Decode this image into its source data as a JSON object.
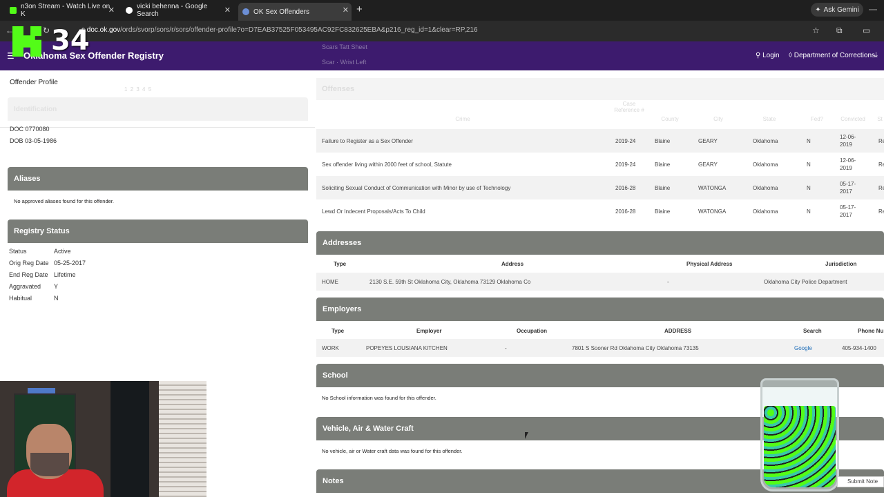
{
  "browser": {
    "tabs": [
      {
        "title": "n3on Stream - Watch Live on K",
        "icon": "kick-favicon"
      },
      {
        "title": "vicki behenna - Google Search",
        "icon": "google-favicon"
      },
      {
        "title": "OK Sex Offenders",
        "icon": "ok-favicon"
      }
    ],
    "new_tab": "+",
    "ask_gemini": "Ask Gemini",
    "url_domain": "s.doc.ok.gov",
    "url_path": "/ords/svorp/sors/r/sors/offender-profile?o=D7EAB37525F053495AC92FC832625EBA&p216_reg_id=1&clear=RP,216"
  },
  "overlay": {
    "stream_number": "34"
  },
  "header": {
    "site_title": "Oklahoma Sex Offender Registry",
    "ghost_line_1": "Scars Tatt Sheet",
    "ghost_line_2": "Scar · Wrist Left",
    "login": "Login",
    "department": "Department of Corrections"
  },
  "left": {
    "page_title": "Offender Profile",
    "pager": "1 2 3 4 5",
    "identification_heading": "Identification",
    "doc_line": "DOC 0770080",
    "dob_line": "DOB 03-05-1986",
    "aliases_heading": "Aliases",
    "aliases_text": "No approved aliases found for this offender.",
    "registry_heading": "Registry Status",
    "registry": [
      {
        "label": "Status",
        "value": "Active"
      },
      {
        "label": "Orig Reg Date",
        "value": "05-25-2017"
      },
      {
        "label": "End Reg Date",
        "value": "Lifetime"
      },
      {
        "label": "Aggravated",
        "value": "Y"
      },
      {
        "label": "Habitual",
        "value": "N"
      }
    ]
  },
  "offenses": {
    "heading": "Offenses",
    "columns": [
      "Crime",
      "Case Reference #",
      "County",
      "City",
      "State",
      "Fed?",
      "Convicted",
      "St"
    ],
    "rows": [
      {
        "crime": "Failure to Register as a Sex Offender",
        "case": "2019-24",
        "county": "Blaine",
        "city": "GEARY",
        "state": "Oklahoma",
        "fed": "N",
        "date_1": "12-06-",
        "date_2": "2019",
        "extra": "Re"
      },
      {
        "crime": "Sex offender living within 2000 feet of school, Statute",
        "case": "2019-24",
        "county": "Blaine",
        "city": "GEARY",
        "state": "Oklahoma",
        "fed": "N",
        "date_1": "12-06-",
        "date_2": "2019",
        "extra": "Re"
      },
      {
        "crime": "Soliciting Sexual Conduct of Communication with Minor by use of Technology",
        "case": "2016-28",
        "county": "Blaine",
        "city": "WATONGA",
        "state": "Oklahoma",
        "fed": "N",
        "date_1": "05-17-",
        "date_2": "2017",
        "extra": "Re"
      },
      {
        "crime": "Lewd Or Indecent Proposals/Acts To Child",
        "case": "2016-28",
        "county": "Blaine",
        "city": "WATONGA",
        "state": "Oklahoma",
        "fed": "N",
        "date_1": "05-17-",
        "date_2": "2017",
        "extra": "Re"
      }
    ]
  },
  "addresses": {
    "heading": "Addresses",
    "columns": [
      "Type",
      "Address",
      "Physical Address",
      "Jurisdiction"
    ],
    "row": {
      "type": "HOME",
      "address": "2130 S.E. 59th St Oklahoma City, Oklahoma 73129 Oklahoma Co",
      "physical": "-",
      "jurisdiction": "Oklahoma City Police Department"
    }
  },
  "employers": {
    "heading": "Employers",
    "columns": [
      "Type",
      "Employer",
      "Occupation",
      "ADDRESS",
      "Search",
      "Phone Nu"
    ],
    "row": {
      "type": "WORK",
      "employer": "POPEYES LOUSIANA KITCHEN",
      "occupation": "-",
      "address": "7801 S Sooner Rd Oklahoma City Oklahoma 73135",
      "search": "Google",
      "phone": "405-934-1400"
    }
  },
  "school": {
    "heading": "School",
    "text": "No School information was found for this offender."
  },
  "vehicle": {
    "heading": "Vehicle, Air & Water Craft",
    "text": "No vehicle, air or Water craft data was found for this offender."
  },
  "notes": {
    "heading": "Notes",
    "submit_note": "Submit Note"
  },
  "colors": {
    "header": "#3d1b6e",
    "panel": "#7a7d78",
    "kick_green": "#53fc18"
  }
}
